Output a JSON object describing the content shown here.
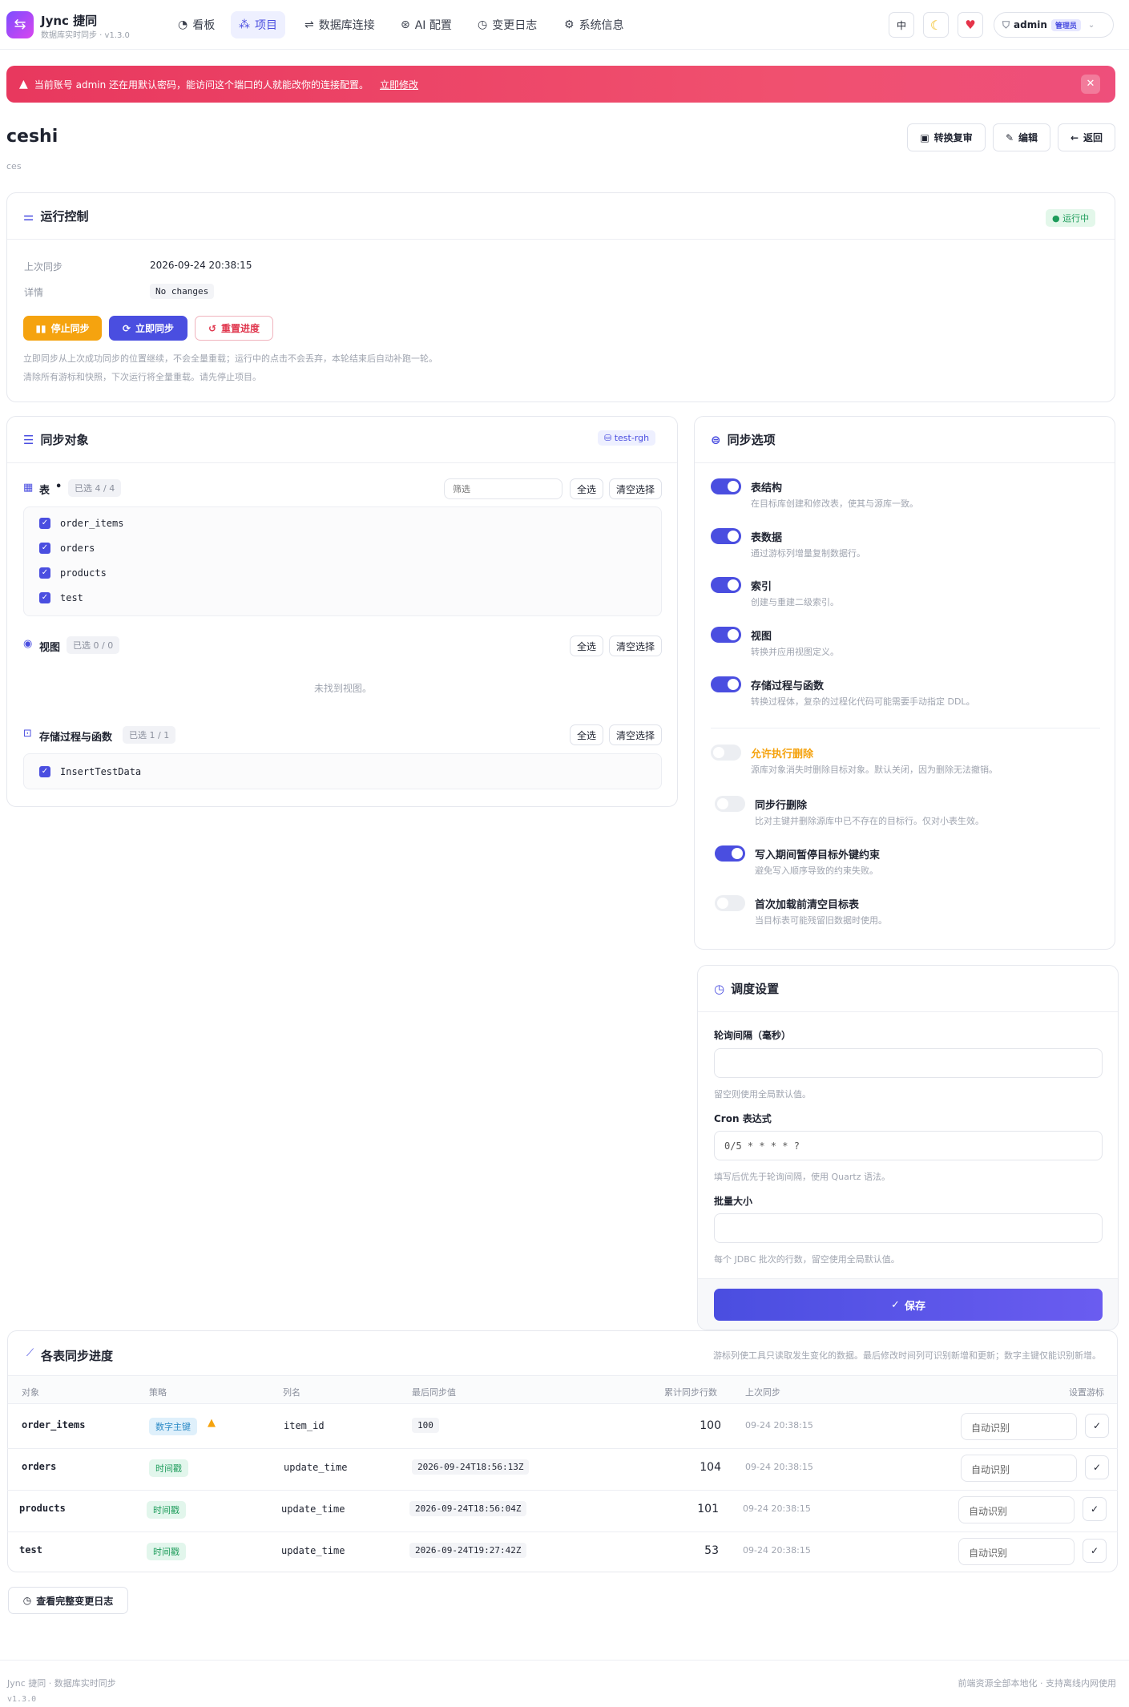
{
  "app": {
    "name": "Jync 捷同",
    "subtitle": "数据库实时同步 · v1.3.0"
  },
  "nav": {
    "items": [
      {
        "label": "看板",
        "icon": "dashboard-icon"
      },
      {
        "label": "项目",
        "icon": "project-icon",
        "active": true
      },
      {
        "label": "数据库连接",
        "icon": "connection-icon"
      },
      {
        "label": "AI 配置",
        "icon": "ai-icon"
      },
      {
        "label": "变更日志",
        "icon": "history-icon"
      },
      {
        "label": "系统信息",
        "icon": "gear-icon"
      }
    ]
  },
  "header": {
    "lang": "中",
    "user": "admin",
    "role": "管理员"
  },
  "alert": {
    "text": "当前账号 admin 还在用默认密码，能访问这个端口的人就能改你的连接配置。",
    "link": "立即修改"
  },
  "project": {
    "name": "ceshi",
    "desc": "ces",
    "actions": {
      "review": "转换复审",
      "edit": "编辑",
      "back": "返回"
    }
  },
  "run": {
    "title": "运行控制",
    "status": "运行中",
    "last_sync_label": "上次同步",
    "last_sync": "2026-09-24 20:38:15",
    "detail_label": "详情",
    "detail": "No changes",
    "stop": "停止同步",
    "sync_now": "立即同步",
    "reset": "重置进度",
    "hint1": "立即同步从上次成功同步的位置继续，不会全量重载；运行中的点击不会丢弃，本轮结束后自动补跑一轮。",
    "hint2": "清除所有游标和快照，下次运行将全量重载。请先停止项目。"
  },
  "objects": {
    "title": "同步对象",
    "db": "test-rgh",
    "tables_label": "表",
    "tables_count": "已选 4 / 4",
    "filter_placeholder": "筛选",
    "select_all": "全选",
    "clear": "清空选择",
    "tables": [
      "order_items",
      "orders",
      "products",
      "test"
    ],
    "views_label": "视图",
    "views_count": "已选 0 / 0",
    "views_empty": "未找到视图。",
    "procs_label": "存储过程与函数",
    "procs_count": "已选 1 / 1",
    "procs": [
      "InsertTestData"
    ]
  },
  "options": {
    "title": "同步选项",
    "items": [
      {
        "title": "表结构",
        "desc": "在目标库创建和修改表，使其与源库一致。",
        "on": true
      },
      {
        "title": "表数据",
        "desc": "通过游标列增量复制数据行。",
        "on": true
      },
      {
        "title": "索引",
        "desc": "创建与重建二级索引。",
        "on": true
      },
      {
        "title": "视图",
        "desc": "转换并应用视图定义。",
        "on": true
      },
      {
        "title": "存储过程与函数",
        "desc": "转换过程体，复杂的过程化代码可能需要手动指定 DDL。",
        "on": true
      },
      {
        "title": "允许执行删除",
        "desc": "源库对象消失时删除目标对象。默认关闭，因为删除无法撤销。",
        "on": false
      },
      {
        "title": "同步行删除",
        "desc": "比对主键并删除源库中已不存在的目标行。仅对小表生效。",
        "on": false
      },
      {
        "title": "写入期间暂停目标外键约束",
        "desc": "避免写入顺序导致的约束失败。",
        "on": true
      },
      {
        "title": "首次加载前清空目标表",
        "desc": "当目标表可能残留旧数据时使用。",
        "on": false
      }
    ]
  },
  "schedule": {
    "title": "调度设置",
    "poll_label": "轮询间隔（毫秒）",
    "poll_value": "",
    "poll_hint": "留空则使用全局默认值。",
    "cron_label": "Cron 表达式",
    "cron_value": "0/5 * * * * ?",
    "cron_hint": "填写后优先于轮询间隔，使用 Quartz 语法。",
    "batch_label": "批量大小",
    "batch_value": "",
    "batch_hint": "每个 JDBC 批次的行数，留空使用全局默认值。",
    "save": "保存"
  },
  "progress": {
    "title": "各表同步进度",
    "note": "游标列使工具只读取发生变化的数据。最后修改时间列可识别新增和更新；数字主键仅能识别新增。",
    "headers": [
      "对象",
      "策略",
      "列名",
      "最后同步值",
      "累计同步行数",
      "上次同步",
      "设置游标"
    ],
    "rows": [
      {
        "object": "order_items",
        "strategy": "数字主键",
        "column": "item_id",
        "last_value": "100",
        "rows": "100",
        "last_sync": "09-24 20:38:15",
        "cursor": "自动识别",
        "warn": true
      },
      {
        "object": "orders",
        "strategy": "时间戳",
        "column": "update_time",
        "last_value": "2026-09-24T18:56:13Z",
        "rows": "104",
        "last_sync": "09-24 20:38:15",
        "cursor": "自动识别"
      },
      {
        "object": "products",
        "strategy": "时间戳",
        "column": "update_time",
        "last_value": "2026-09-24T18:56:04Z",
        "rows": "101",
        "last_sync": "09-24 20:38:15",
        "cursor": "自动识别"
      },
      {
        "object": "test",
        "strategy": "时间戳",
        "column": "update_time",
        "last_value": "2026-09-24T19:27:42Z",
        "rows": "53",
        "last_sync": "09-24 20:38:15",
        "cursor": "自动识别"
      }
    ]
  },
  "log_button": "查看完整变更日志",
  "footer": {
    "left": "Jync 捷同 · 数据库实时同步",
    "version": "v1.3.0",
    "right": "前端资源全部本地化 · 支持离线内网使用"
  }
}
